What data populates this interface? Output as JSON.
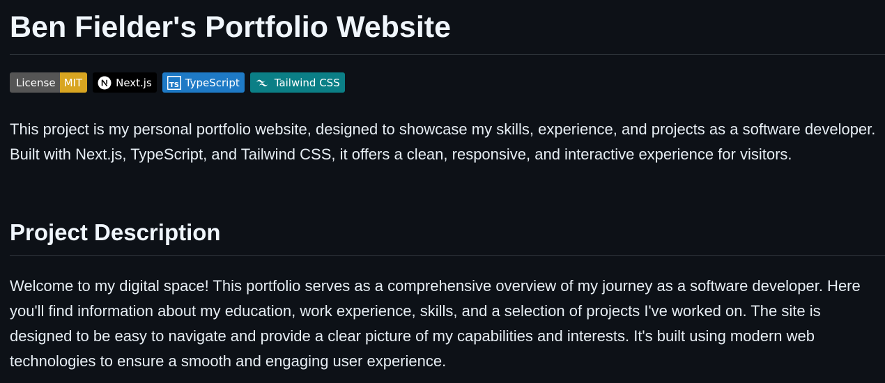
{
  "title": "Ben Fielder's Portfolio Website",
  "badges": {
    "license_label": "License",
    "license_value": "MIT",
    "nextjs_label": "Next.js",
    "typescript_label": "TypeScript",
    "tailwind_label": "Tailwind CSS",
    "colors": {
      "license_left": "#555555",
      "license_right": "#d8a521",
      "nextjs": "#000000",
      "typescript": "#1e7ac6",
      "tailwind": "#0b7f86"
    },
    "icons": [
      "nextjs-icon",
      "typescript-icon",
      "tailwind-icon"
    ]
  },
  "intro": "This project is my personal portfolio website, designed to showcase my skills, experience, and projects as a software developer. Built with Next.js, TypeScript, and Tailwind CSS, it offers a clean, responsive, and interactive experience for visitors.",
  "section": {
    "heading": "Project Description",
    "body": "Welcome to my digital space! This portfolio serves as a comprehensive overview of my journey as a software developer. Here you'll find information about my education, work experience, skills, and a selection of projects I've worked on. The site is designed to be easy to navigate and provide a clear picture of my capabilities and interests. It's built using modern web technologies to ensure a smooth and engaging user experience."
  }
}
